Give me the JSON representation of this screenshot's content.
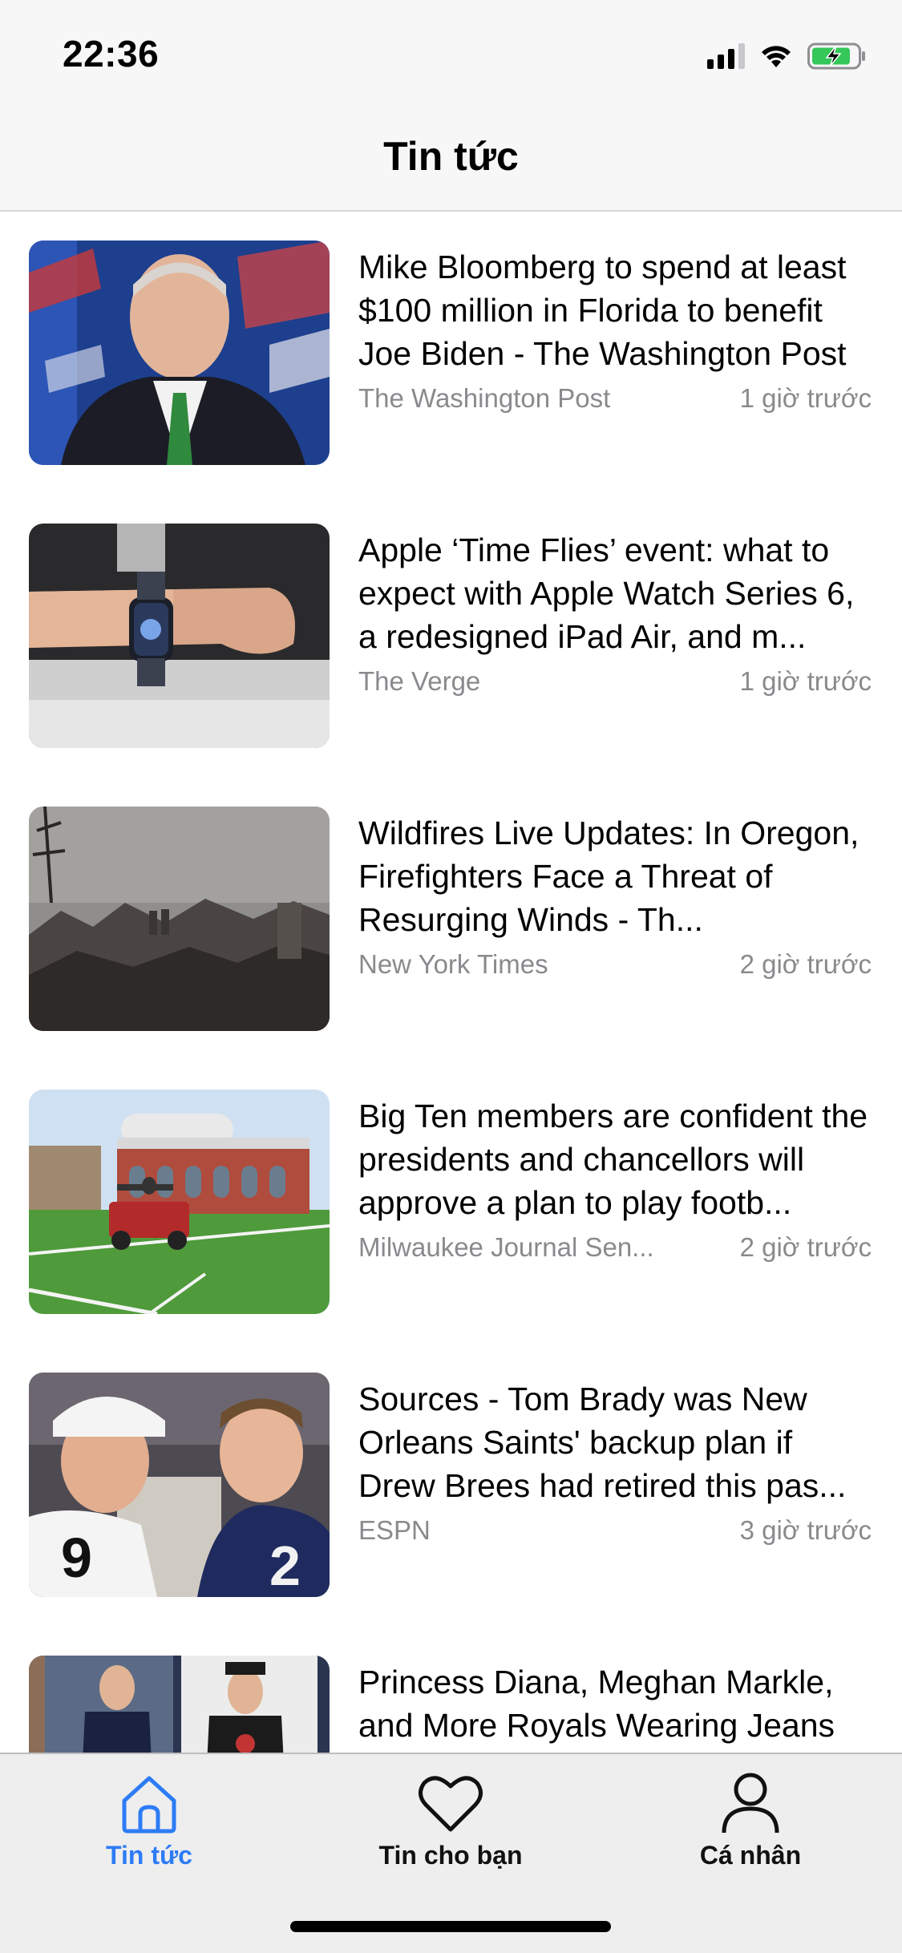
{
  "status_bar": {
    "time": "22:36",
    "battery_color": "#34c759"
  },
  "nav": {
    "title": "Tin tức"
  },
  "articles": [
    {
      "title": "Mike Bloomberg to spend at least $100 million in Florida to benefit Joe Biden - The Washington Post",
      "source": "The Washington Post",
      "time": "1 giờ trước"
    },
    {
      "title": "Apple ‘Time Flies’ event: what to expect with Apple Watch Series 6, a redesigned iPad Air, and m...",
      "source": "The Verge",
      "time": "1 giờ trước"
    },
    {
      "title": "Wildfires Live Updates: In Oregon, Firefighters Face a Threat of Resurging Winds - Th...",
      "source": "New York Times",
      "time": "2 giờ trước"
    },
    {
      "title": "Big Ten members are confident the presidents and chancellors will approve a plan to play footb...",
      "source": "Milwaukee Journal Sen...",
      "time": "2 giờ trước"
    },
    {
      "title": "Sources - Tom Brady was New Orleans Saints' backup plan if Drew Brees had retired this pas...",
      "source": "ESPN",
      "time": "3 giờ trước"
    },
    {
      "title": "Princess Diana, Meghan Markle, and More Royals Wearing Jeans",
      "source": "",
      "time": ""
    }
  ],
  "tabs": [
    {
      "label": "Tin tức",
      "icon": "home-icon",
      "active": true
    },
    {
      "label": "Tin cho bạn",
      "icon": "heart-icon",
      "active": false
    },
    {
      "label": "Cá nhân",
      "icon": "person-icon",
      "active": false
    }
  ],
  "colors": {
    "accent": "#2d7cf6",
    "meta_text": "#8a8a8e",
    "tab_bar_bg": "#eeeeef"
  }
}
